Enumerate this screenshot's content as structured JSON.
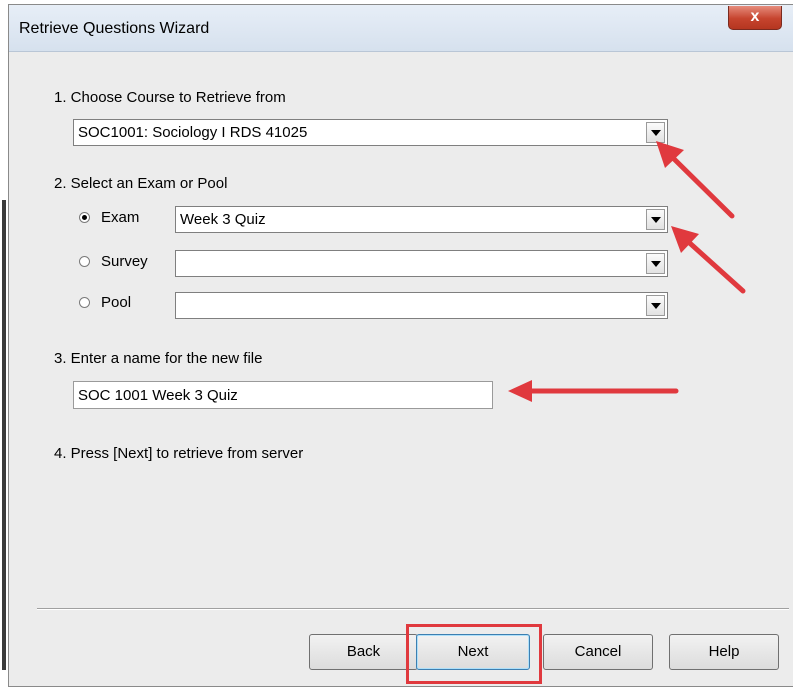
{
  "window": {
    "title": "Retrieve Questions Wizard",
    "close_label": "x"
  },
  "step1": {
    "label": "1.  Choose Course to Retrieve from",
    "course_value": "SOC1001: Sociology I RDS 41025"
  },
  "step2": {
    "label": "2.  Select an Exam or Pool",
    "options": [
      {
        "label": "Exam",
        "checked": true,
        "value": "Week 3 Quiz"
      },
      {
        "label": "Survey",
        "checked": false,
        "value": ""
      },
      {
        "label": "Pool",
        "checked": false,
        "value": ""
      }
    ]
  },
  "step3": {
    "label": "3.  Enter a name for the new file",
    "file_name": "SOC 1001 Week 3 Quiz"
  },
  "step4": {
    "label": "4.  Press [Next] to retrieve from server"
  },
  "buttons": {
    "back": "Back",
    "next": "Next",
    "cancel": "Cancel",
    "help": "Help"
  },
  "annotation_color": "#e0393e"
}
